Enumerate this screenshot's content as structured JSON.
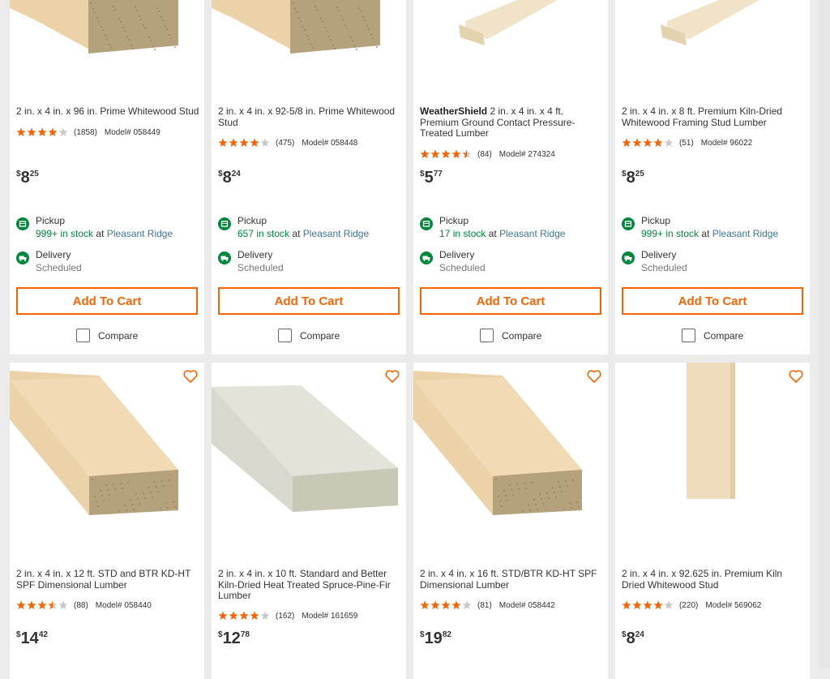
{
  "colors": {
    "accent": "#f96302",
    "link": "#3e7697",
    "stock": "#00873c",
    "star": "#f96302",
    "fulfillment_icon": "#00873c"
  },
  "labels": {
    "add_to_cart": "Add To Cart",
    "compare": "Compare",
    "pickup": "Pickup",
    "delivery": "Delivery",
    "scheduled": "Scheduled",
    "in_stock": "in stock",
    "at": "at",
    "model_prefix": "Model#",
    "currency": "$"
  },
  "products": [
    {
      "brand": "",
      "title": "2 in. x 4 in. x 96 in. Prime Whitewood Stud",
      "rating": 4,
      "reviews": "(1858)",
      "model": "058449",
      "price_dollars": "8",
      "price_cents": "25",
      "stock": "999+",
      "store": "Pleasant Ridge",
      "image": "lumber-end-view-icon"
    },
    {
      "brand": "",
      "title": "2 in. x 4 in. x 92-5/8 in. Prime Whitewood Stud",
      "rating": 4,
      "reviews": "(475)",
      "model": "058448",
      "price_dollars": "8",
      "price_cents": "24",
      "stock": "657",
      "store": "Pleasant Ridge",
      "image": "lumber-end-view-icon"
    },
    {
      "brand": "WeatherShield",
      "title": "2 in. x 4 in. x 4 ft. Premium Ground Contact Pressure-Treated Lumber",
      "rating": 4.5,
      "reviews": "(84)",
      "model": "274324",
      "price_dollars": "5",
      "price_cents": "77",
      "stock": "17",
      "store": "Pleasant Ridge",
      "image": "lumber-diagonal-icon"
    },
    {
      "brand": "",
      "title": "2 in. x 4 in. x 8 ft. Premium Kiln-Dried Whitewood Framing Stud Lumber",
      "rating": 4,
      "reviews": "(51)",
      "model": "96022",
      "price_dollars": "8",
      "price_cents": "25",
      "stock": "999+",
      "store": "Pleasant Ridge",
      "image": "lumber-diagonal-icon"
    },
    {
      "brand": "",
      "title": "2 in. x 4 in. x 12 ft. STD and BTR KD-HT SPF Dimensional Lumber",
      "rating": 3.5,
      "reviews": "(88)",
      "model": "058440",
      "price_dollars": "14",
      "price_cents": "42",
      "image": "lumber-end-view-icon"
    },
    {
      "brand": "",
      "title": "2 in. x 4 in. x 10 ft. Standard and Better Kiln-Dried Heat Treated Spruce-Pine-Fir Lumber",
      "rating": 4,
      "reviews": "(162)",
      "model": "161659",
      "price_dollars": "12",
      "price_cents": "78",
      "image": "lumber-gray-icon"
    },
    {
      "brand": "",
      "title": "2 in. x 4 in. x 16 ft. STD/BTR KD-HT SPF Dimensional Lumber",
      "rating": 4,
      "reviews": "(81)",
      "model": "058442",
      "price_dollars": "19",
      "price_cents": "82",
      "image": "lumber-end-view-icon"
    },
    {
      "brand": "",
      "title": "2 in. x 4 in. x 92.625 in. Premium Kiln Dried Whitewood Stud",
      "rating": 4,
      "reviews": "(220)",
      "model": "569062",
      "price_dollars": "8",
      "price_cents": "24",
      "image": "lumber-vertical-icon"
    }
  ]
}
